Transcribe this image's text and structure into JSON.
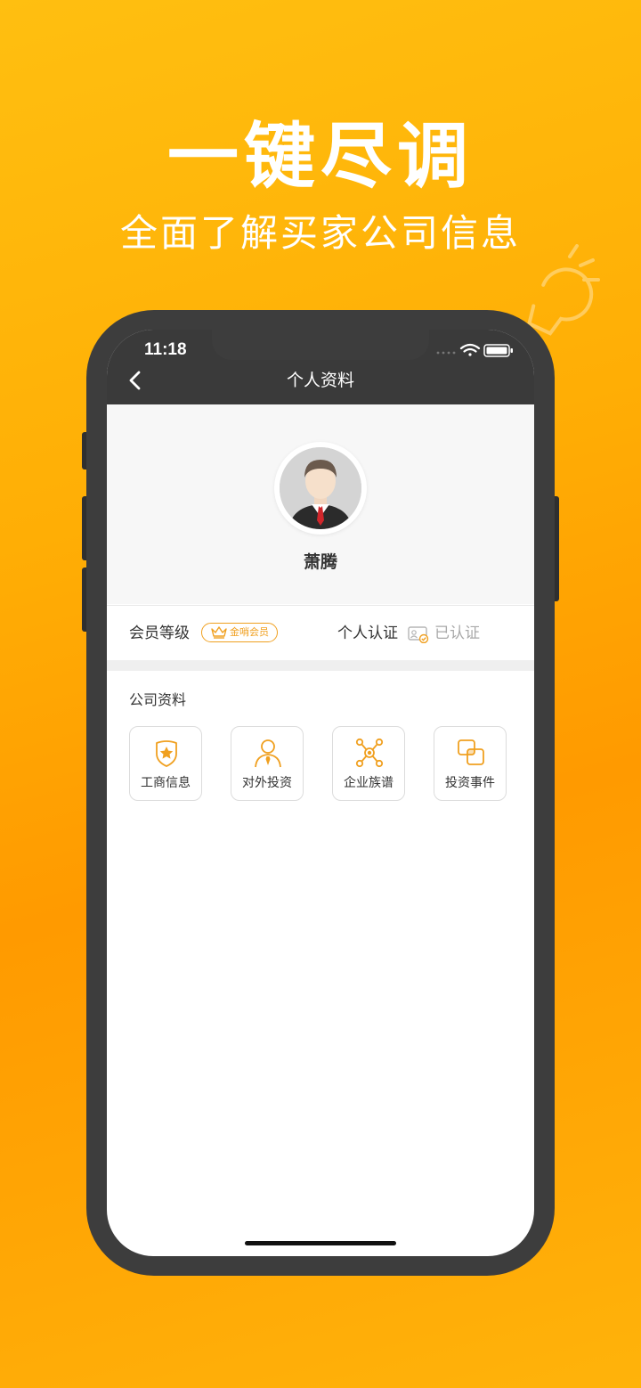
{
  "promo": {
    "headline": "一键尽调",
    "subline": "全面了解买家公司信息"
  },
  "status_bar": {
    "time": "11:18",
    "icons": [
      "signal-dots-icon",
      "wifi-icon",
      "battery-icon"
    ]
  },
  "nav": {
    "back_icon": "chevron-left-icon",
    "title": "个人资料"
  },
  "profile": {
    "name": "萧腾"
  },
  "info_row": {
    "member_label": "会员等级",
    "member_badge": "金哨会员",
    "cert_label": "个人认证",
    "cert_status": "已认证"
  },
  "company": {
    "section_title": "公司资料",
    "tiles": [
      {
        "label": "工商信息",
        "icon": "shield-star-icon"
      },
      {
        "label": "对外投资",
        "icon": "person-tie-icon"
      },
      {
        "label": "企业族谱",
        "icon": "network-icon"
      },
      {
        "label": "投资事件",
        "icon": "overlap-squares-icon"
      }
    ]
  },
  "colors": {
    "background_start": "#ffbf10",
    "background_end": "#ff9a00",
    "accent": "#f0a020",
    "phone_frame": "#3d3d3d"
  }
}
